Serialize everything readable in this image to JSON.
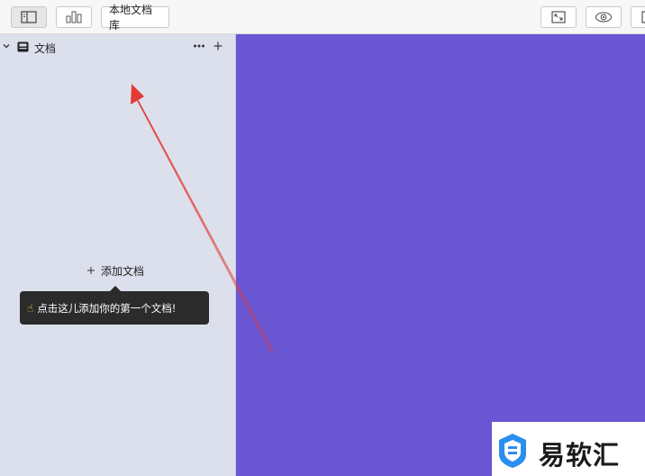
{
  "toolbar": {
    "library_label": "本地文档库"
  },
  "sidebar": {
    "root_label": "文档",
    "add_doc_label": "添加文档",
    "tooltip_text": "点击这儿添加你的第一个文档!",
    "tooltip_icon": "pointing-hand-icon"
  },
  "colors": {
    "toolbar_bg": "#f7f7f7",
    "sidebar_bg": "#dce0ec",
    "main_bg": "#6a55d2",
    "tooltip_bg": "#2b2b2b",
    "annotation_arrow": "#e53935",
    "watermark_logo": "#2b8ef0"
  },
  "watermark": {
    "text": "易软汇",
    "logo_icon": "shield-logo-icon"
  }
}
